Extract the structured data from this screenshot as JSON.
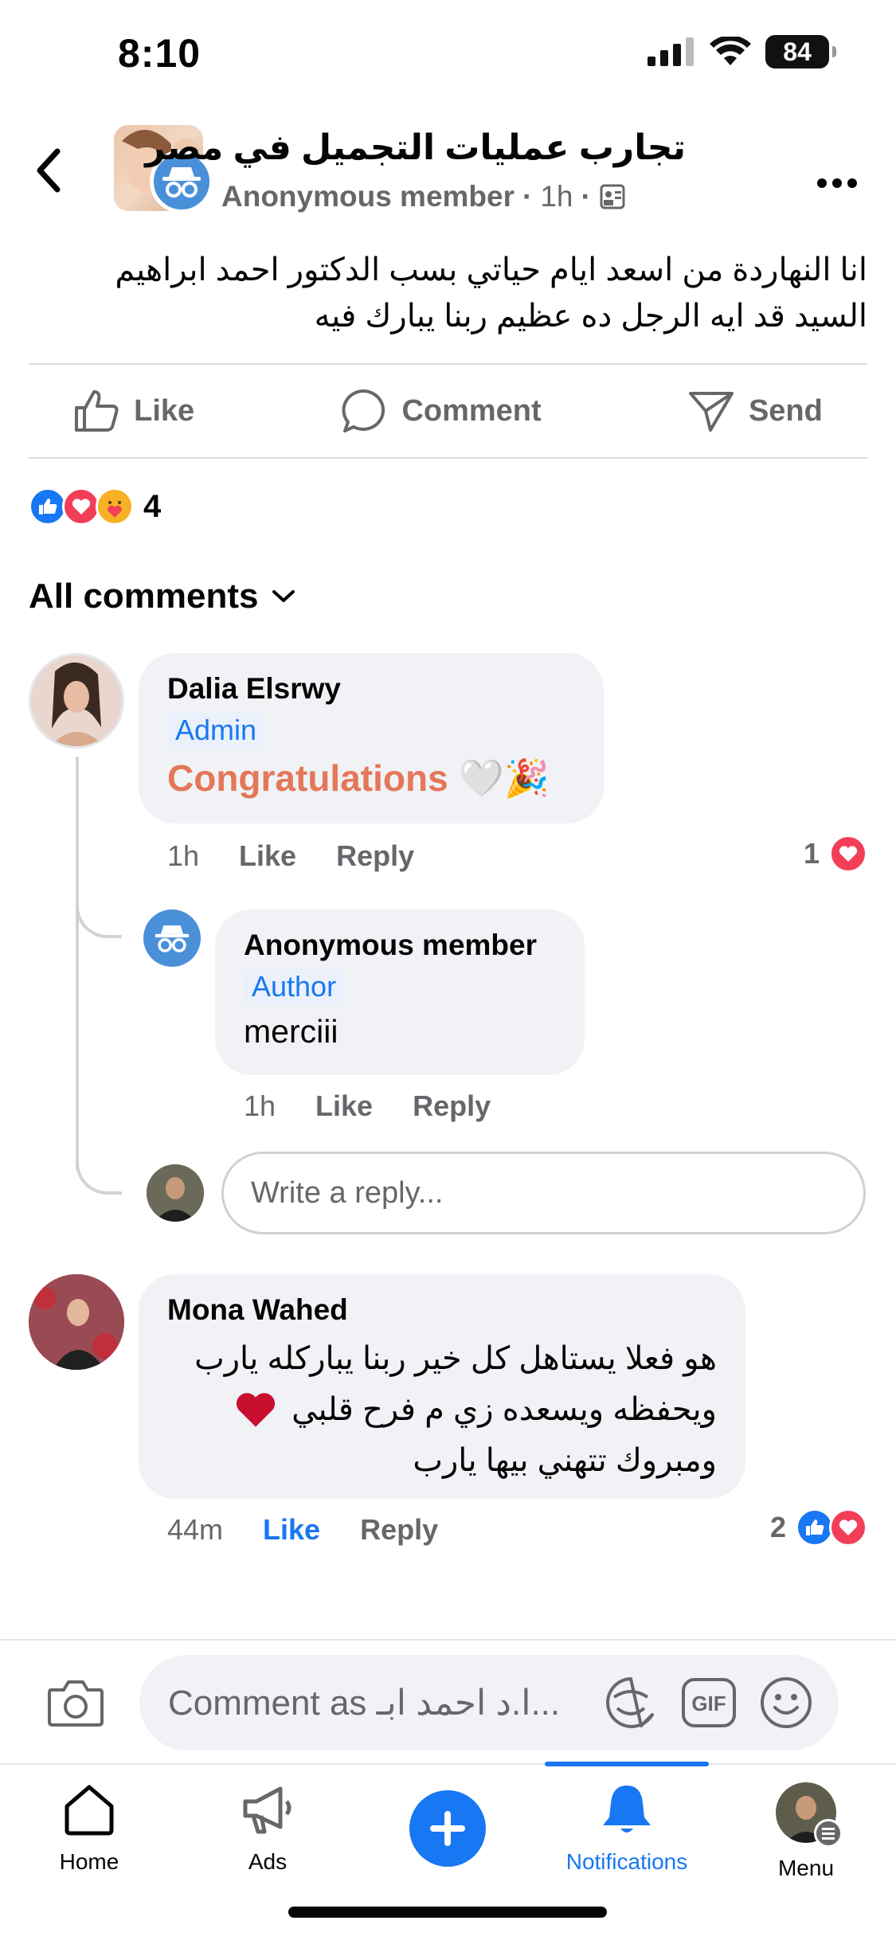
{
  "status": {
    "time": "8:10",
    "battery": "84"
  },
  "header": {
    "group_name": "تجارب عمليات التجميل في مصر",
    "author": "Anonymous member",
    "separator": "·",
    "time": "1h"
  },
  "post": {
    "text_line1": "انا النهاردة من اسعد ايام حياتي  بسب الدكتور  احمد ابراهيم",
    "text_line2": "السيد قد ايه الرجل ده عظيم ربنا يبارك فيه"
  },
  "actions": {
    "like": "Like",
    "comment": "Comment",
    "send": "Send"
  },
  "reactions": {
    "count": "4"
  },
  "comments_header": {
    "label": "All comments"
  },
  "comments": [
    {
      "name": "Dalia Elsrwy",
      "role": "Admin",
      "text": "Congratulations 🤍🎉",
      "time": "1h",
      "like": "Like",
      "reply": "Reply",
      "reaction_count": "1"
    },
    {
      "name": "Anonymous member",
      "role": "Author",
      "text": "merciii",
      "time": "1h",
      "like": "Like",
      "reply": "Reply"
    },
    {
      "name": "Mona Wahed",
      "text_line1": "هو فعلا يستاهل كل خير ربنا يباركله يارب",
      "text_line2": "ويحفظه ويسعده زي م فرح قلبي",
      "text_line3": "ومبروك تتهني بيها يارب",
      "time": "44m",
      "like": "Like",
      "reply": "Reply",
      "reaction_count": "2"
    }
  ],
  "reply_box": {
    "placeholder": "Write a reply..."
  },
  "composer": {
    "placeholder": "Comment as ا.د احمد ابـ..."
  },
  "tabs": [
    {
      "label": "Home",
      "icon": "home-icon"
    },
    {
      "label": "Ads",
      "icon": "megaphone-icon"
    },
    {
      "label": "",
      "icon": "plus-icon"
    },
    {
      "label": "Notifications",
      "icon": "bell-icon"
    },
    {
      "label": "Menu",
      "icon": "avatar-menu-icon"
    }
  ],
  "colors": {
    "accent": "#1877f2",
    "congrats": "#e4775a",
    "heart": "#f33e58"
  }
}
